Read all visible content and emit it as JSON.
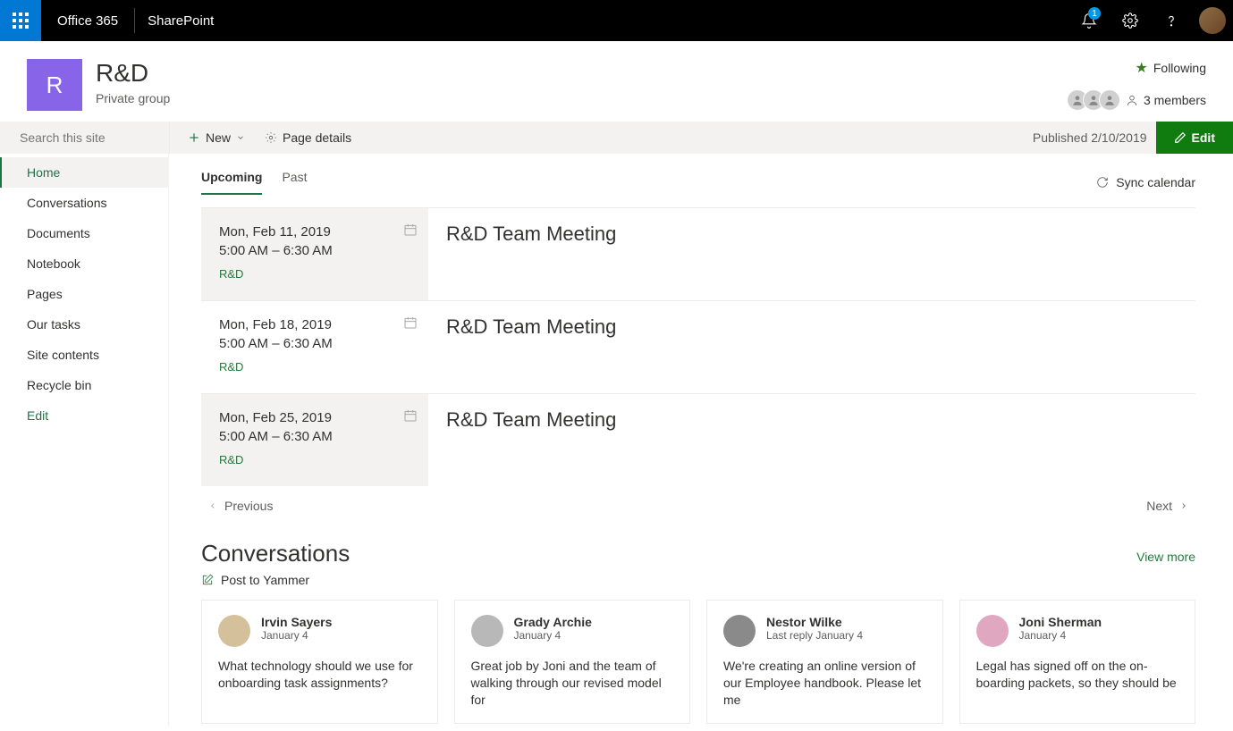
{
  "topbar": {
    "brand": "Office 365",
    "app": "SharePoint",
    "notif_count": "1"
  },
  "site": {
    "logo_letter": "R",
    "title": "R&D",
    "subtitle": "Private group",
    "following_label": "Following",
    "members_label": "3 members"
  },
  "search": {
    "placeholder": "Search this site"
  },
  "cmd": {
    "new_label": "New",
    "page_details_label": "Page details",
    "published": "Published 2/10/2019",
    "edit_label": "Edit"
  },
  "nav": {
    "items": [
      "Home",
      "Conversations",
      "Documents",
      "Notebook",
      "Pages",
      "Our tasks",
      "Site contents",
      "Recycle bin",
      "Edit"
    ],
    "active_index": 0
  },
  "calendar": {
    "tabs": [
      "Upcoming",
      "Past"
    ],
    "active_tab": 0,
    "sync_label": "Sync calendar",
    "events": [
      {
        "date": "Mon, Feb 11, 2019",
        "time": "5:00 AM – 6:30 AM",
        "category": "R&D",
        "title": "R&D Team Meeting",
        "selected": true
      },
      {
        "date": "Mon, Feb 18, 2019",
        "time": "5:00 AM – 6:30 AM",
        "category": "R&D",
        "title": "R&D Team Meeting",
        "selected": false
      },
      {
        "date": "Mon, Feb 25, 2019",
        "time": "5:00 AM – 6:30 AM",
        "category": "R&D",
        "title": "R&D Team Meeting",
        "selected": true
      }
    ],
    "prev_label": "Previous",
    "next_label": "Next"
  },
  "conversations": {
    "heading": "Conversations",
    "view_more": "View more",
    "post_label": "Post to Yammer",
    "cards": [
      {
        "name": "Irvin Sayers",
        "date": "January 4",
        "body": "What technology should we use for onboarding task assignments?"
      },
      {
        "name": "Grady Archie",
        "date": "January 4",
        "body": "Great job by Joni and the team of walking through our revised model for"
      },
      {
        "name": "Nestor Wilke",
        "date": "Last reply January 4",
        "body": "We're creating an online version of our Employee handbook. Please let me"
      },
      {
        "name": "Joni Sherman",
        "date": "January 4",
        "body": "Legal has signed off on the on-boarding packets, so they should be"
      }
    ]
  }
}
